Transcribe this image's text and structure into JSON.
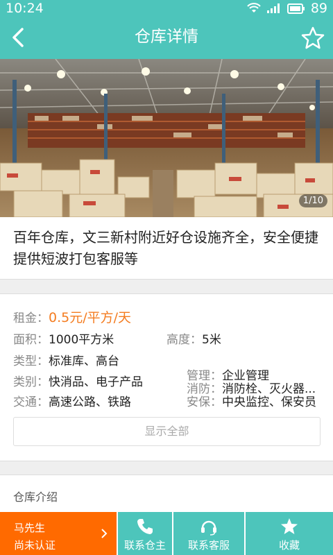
{
  "status_bar": {
    "time": "10:24",
    "battery": "89"
  },
  "header": {
    "title": "仓库详情"
  },
  "carousel": {
    "counter": "1/10"
  },
  "warehouse": {
    "title": "百年仓库，文三新村附近好仓设施齐全，安全便捷提供短波打包客服等"
  },
  "specs": {
    "rent_label": "租金：",
    "rent_value": "0.5元/平方/天",
    "area_label": "面积：",
    "area_value": "1000平方米",
    "height_label": "高度：",
    "height_value": "5米",
    "type_label": "类型：",
    "type_value": "标准库、高台",
    "category_label": "类别：",
    "category_value": "快消品、电子产品",
    "management_label": "管理：",
    "management_value": "企业管理",
    "fire_label": "消防：",
    "fire_value": "消防栓、灭火器...",
    "transport_label": "交通：",
    "transport_value": "高速公路、铁路",
    "security_label": "安保：",
    "security_value": "中央监控、保安员",
    "show_all": "显示全部"
  },
  "intro": {
    "title": "仓库介绍"
  },
  "bottom_bar": {
    "owner_name": "马先生",
    "owner_status": "尚未认证",
    "actions": [
      {
        "label": "联系仓主",
        "icon": "phone-icon"
      },
      {
        "label": "联系客服",
        "icon": "headset-icon"
      },
      {
        "label": "收藏",
        "icon": "star-icon"
      }
    ]
  },
  "colors": {
    "primary": "#4dc5bb",
    "accent": "#ff6a00",
    "price": "#f47c20"
  }
}
